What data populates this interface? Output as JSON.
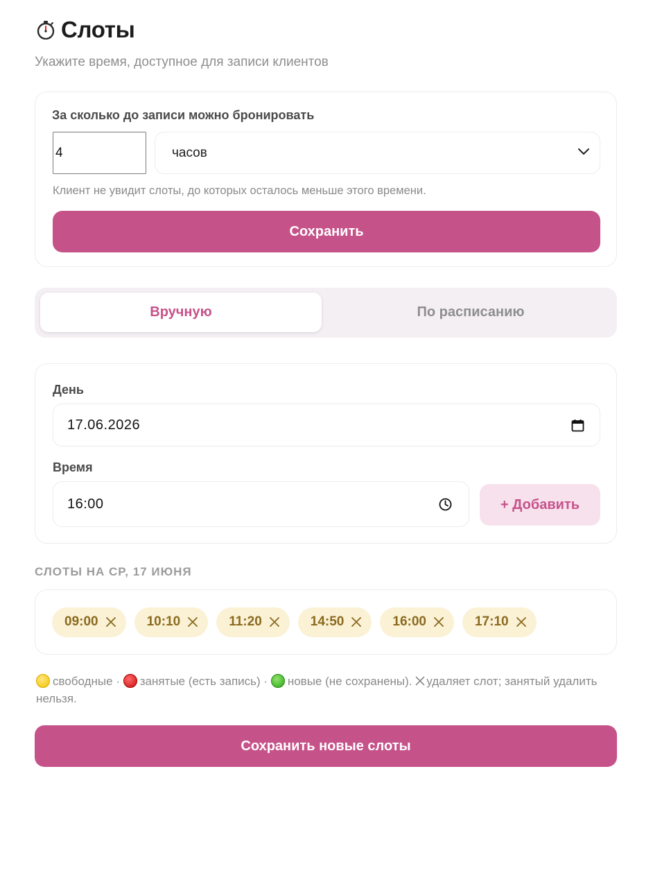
{
  "header": {
    "icon": "stopwatch-icon",
    "title": "Слоты",
    "subtitle": "Укажите время, доступное для записи клиентов"
  },
  "booking": {
    "label": "За сколько до записи можно бронировать",
    "amount_value": "4",
    "unit_value": "часов",
    "hint": "Клиент не увидит слоты, до которых осталось меньше этого времени.",
    "save_label": "Сохранить"
  },
  "mode_tabs": [
    {
      "label": "Вручную",
      "active": true
    },
    {
      "label": "По расписанию",
      "active": false
    }
  ],
  "slot_form": {
    "day_label": "День",
    "day_value": "17.06.2026",
    "time_label": "Время",
    "time_value": "16:00",
    "add_label": "+ Добавить"
  },
  "slots": {
    "section_title": "Слоты на ср, 17 июня",
    "items": [
      "09:00",
      "10:10",
      "11:20",
      "14:50",
      "16:00",
      "17:10"
    ]
  },
  "legend": {
    "free": "свободные ·",
    "busy": "занятые (есть запись) ·",
    "new": "новые (не сохранены).",
    "remove_note": "удаляет слот; занятый удалить нельзя."
  },
  "save_all_label": "Сохранить новые слоты",
  "colors": {
    "accent": "#c6528a",
    "accent_soft": "#f7e1ec",
    "chip_bg": "#fbf1d5",
    "chip_text": "#8a6a1e",
    "segment_bg": "#f4eff3"
  }
}
